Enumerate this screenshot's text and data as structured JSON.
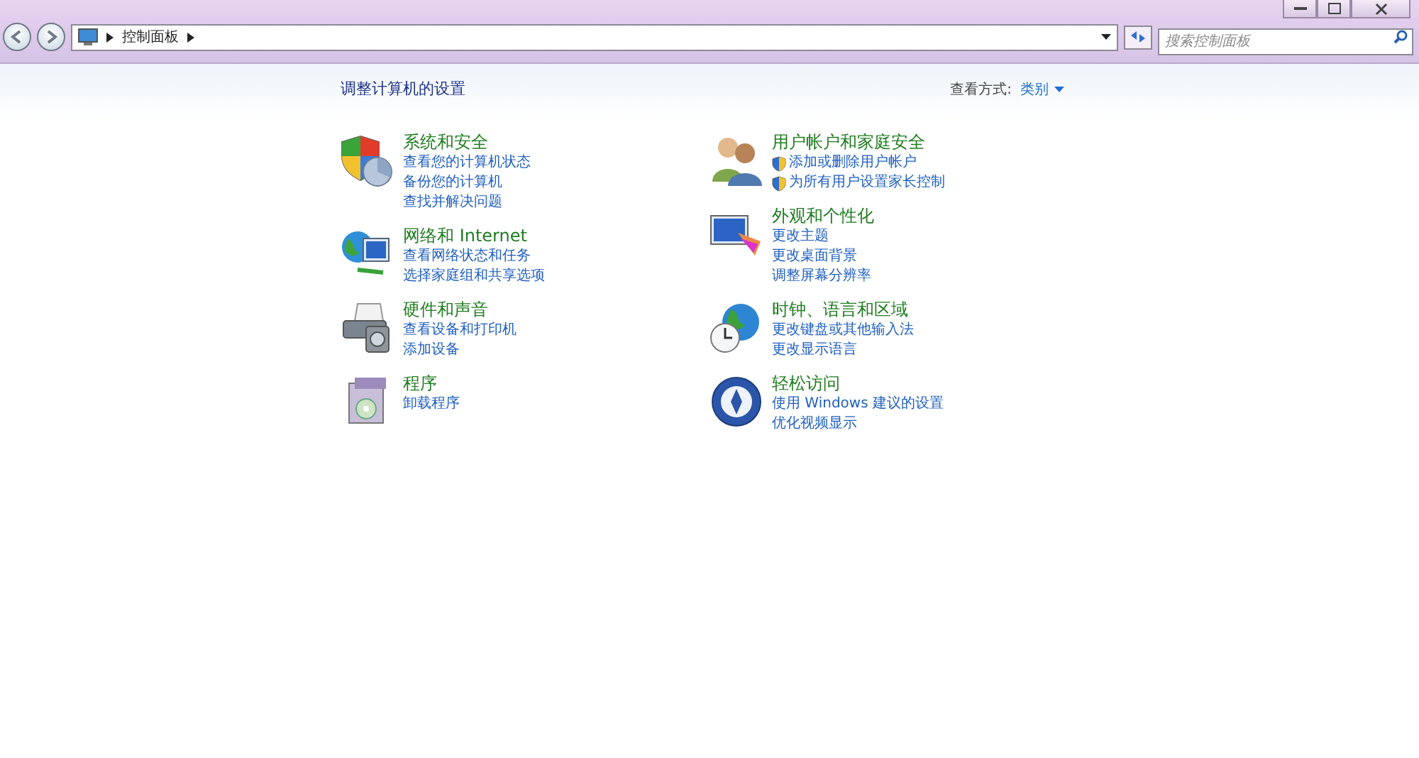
{
  "address_bar": {
    "breadcrumb": [
      "控制面板"
    ]
  },
  "search": {
    "placeholder": "搜索控制面板"
  },
  "page_title": "调整计算机的设置",
  "view_by": {
    "label": "查看方式:",
    "value": "类别"
  },
  "columns": [
    {
      "categories": [
        {
          "title": "系统和安全",
          "links": [
            {
              "text": "查看您的计算机状态",
              "kind": "plain"
            },
            {
              "text": "备份您的计算机",
              "kind": "plain"
            },
            {
              "text": "查找并解决问题",
              "kind": "plain"
            }
          ]
        },
        {
          "title": "网络和 Internet",
          "links": [
            {
              "text": "查看网络状态和任务",
              "kind": "plain"
            },
            {
              "text": "选择家庭组和共享选项",
              "kind": "plain"
            }
          ]
        },
        {
          "title": "硬件和声音",
          "links": [
            {
              "text": "查看设备和打印机",
              "kind": "plain"
            },
            {
              "text": "添加设备",
              "kind": "plain"
            }
          ]
        },
        {
          "title": "程序",
          "links": [
            {
              "text": "卸载程序",
              "kind": "plain"
            }
          ]
        }
      ]
    },
    {
      "categories": [
        {
          "title": "用户帐户和家庭安全",
          "links": [
            {
              "text": "添加或删除用户帐户",
              "kind": "shield"
            },
            {
              "text": "为所有用户设置家长控制",
              "kind": "shield"
            }
          ]
        },
        {
          "title": "外观和个性化",
          "links": [
            {
              "text": "更改主题",
              "kind": "plain"
            },
            {
              "text": "更改桌面背景",
              "kind": "plain"
            },
            {
              "text": "调整屏幕分辨率",
              "kind": "plain"
            }
          ]
        },
        {
          "title": "时钟、语言和区域",
          "links": [
            {
              "text": "更改键盘或其他输入法",
              "kind": "plain"
            },
            {
              "text": "更改显示语言",
              "kind": "plain"
            }
          ]
        },
        {
          "title": "轻松访问",
          "links": [
            {
              "text": "使用 Windows 建议的设置",
              "kind": "plain"
            },
            {
              "text": "优化视频显示",
              "kind": "plain"
            }
          ]
        }
      ]
    }
  ]
}
